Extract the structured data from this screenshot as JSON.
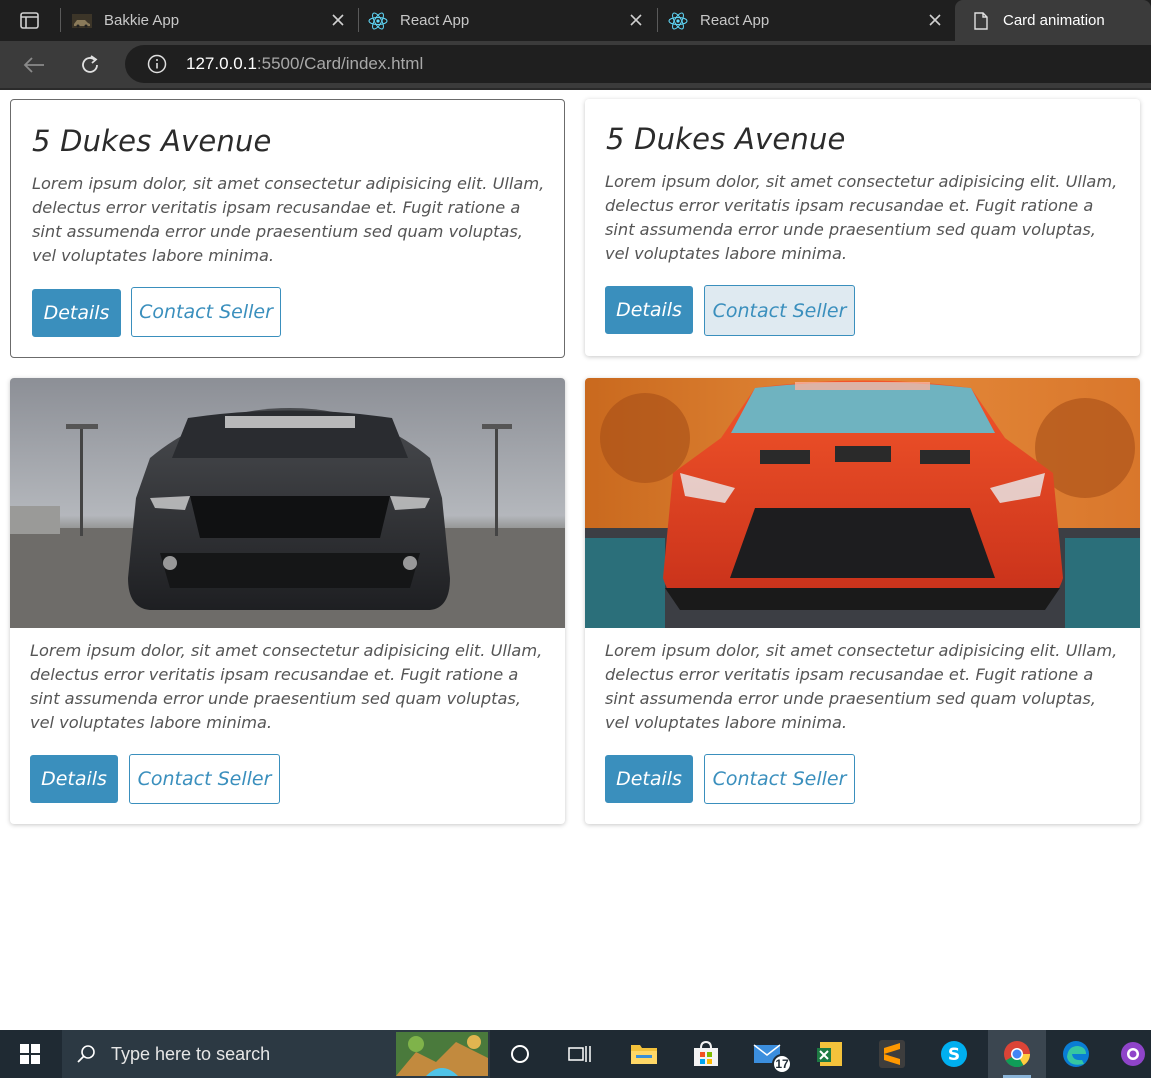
{
  "browser": {
    "tabs": [
      {
        "title": "Bakkie App",
        "favicon": "car-favicon",
        "active": false
      },
      {
        "title": "React App",
        "favicon": "react-icon",
        "active": false
      },
      {
        "title": "React App",
        "favicon": "react-icon",
        "active": false
      },
      {
        "title": "Card animation",
        "favicon": "document-icon",
        "active": true
      }
    ],
    "url_host": "127.0.0.1",
    "url_path": ":5500/Card/index.html"
  },
  "cards": [
    {
      "title": "5 Dukes Avenue",
      "text": "Lorem ipsum dolor, sit amet consectetur adipisicing elit. Ullam, delectus error veritatis ipsam recusandae et. Fugit ratione a sint assumenda error unde praesentium sed quam voluptas, vel voluptates labore minima.",
      "details_label": "Details",
      "contact_label": "Contact Seller"
    },
    {
      "title": "5 Dukes Avenue",
      "text": "Lorem ipsum dolor, sit amet consectetur adipisicing elit. Ullam, delectus error veritatis ipsam recusandae et. Fugit ratione a sint assumenda error unde praesentium sed quam voluptas, vel voluptates labore minima.",
      "details_label": "Details",
      "contact_label": "Contact Seller"
    },
    {
      "image": "grey-mustang-car-photo",
      "text": "Lorem ipsum dolor, sit amet consectetur adipisicing elit. Ullam, delectus error veritatis ipsam recusandae et. Fugit ratione a sint assumenda error unde praesentium sed quam voluptas, vel voluptates labore minima.",
      "details_label": "Details",
      "contact_label": "Contact Seller"
    },
    {
      "image": "red-gtr-car-photo",
      "text": "Lorem ipsum dolor, sit amet consectetur adipisicing elit. Ullam, delectus error veritatis ipsam recusandae et. Fugit ratione a sint assumenda error unde praesentium sed quam voluptas, vel voluptates labore minima.",
      "details_label": "Details",
      "contact_label": "Contact Seller"
    }
  ],
  "taskbar": {
    "search_placeholder": "Type here to search",
    "mail_badge": "17",
    "icons": [
      "windows-start-icon",
      "search-icon",
      "cortana-icon",
      "task-view-icon",
      "file-explorer-icon",
      "store-icon",
      "mail-icon",
      "excel-icon",
      "sublime-icon",
      "skype-icon",
      "chrome-icon",
      "edge-icon",
      "github-desktop-icon"
    ]
  },
  "colors": {
    "accent": "#3a8fbd",
    "card_text": "#555555",
    "title_text": "#2b2b2b",
    "browser_dark": "#1f1f1f",
    "taskbar": "#1f2a33"
  }
}
